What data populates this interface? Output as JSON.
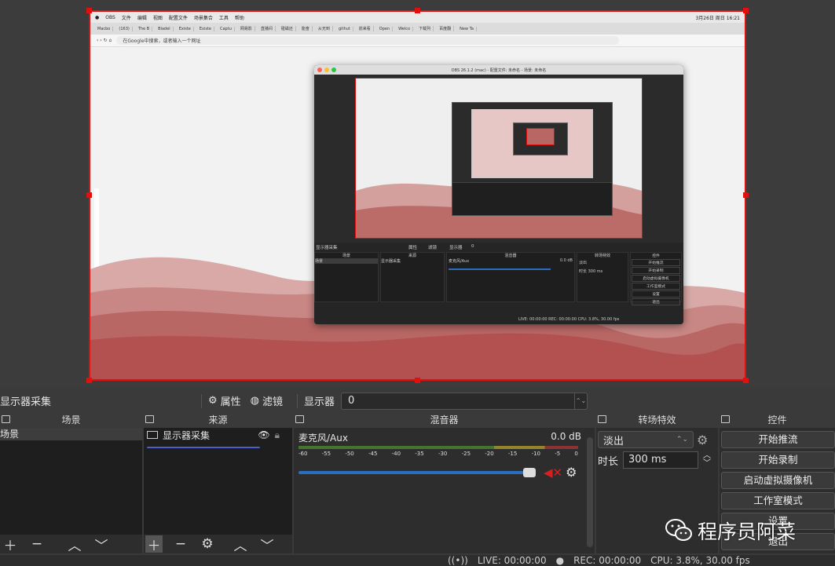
{
  "nested": {
    "mac_menu": [
      "OBS",
      "文件",
      "编辑",
      "视图",
      "配置文件",
      "场景集合",
      "工具",
      "帮助"
    ],
    "mac_clock": "3月26日 周日 16:21",
    "browser_tabs": [
      "Macbo",
      "(163)",
      "The B",
      "Bladel",
      "Existe",
      "Existe",
      "Captu",
      "网易影",
      "直播间",
      "碰磁还",
      "能奋",
      "从无到",
      "githut",
      "前来看",
      "Open",
      "Welco",
      "下载列",
      "百度翻",
      "New Ta"
    ],
    "address_text": "在Google中搜索，或者输入一个网址",
    "obs_window_title": "OBS 26.1.2 (mac) - 配置文件: 未命名 - 场景: 未命名",
    "obs_inner_labels": {
      "scene_bar": "显示器采集",
      "props": "属性",
      "filters": "滤镜",
      "display": "显示器",
      "display_val": "0",
      "scenes": "场景",
      "sources": "来源",
      "mixer": "混音器",
      "transitions": "转场特效",
      "controls": "控件",
      "scene_item": "场景",
      "source_item": "显示器采集",
      "mic": "麦克风/Aux",
      "mic_db": "0.0 dB",
      "fade": "淡出",
      "duration_label": "时长",
      "duration_val": "300 ms",
      "buttons": [
        "开始推流",
        "开始录制",
        "启动虚拟摄像机",
        "工作室模式",
        "设置",
        "退出"
      ],
      "status": "LIVE: 00:00:00   REC: 00:00:00   CPU: 3.8%, 30.00 fps"
    }
  },
  "scene_bar": {
    "source_name": "显示器采集",
    "properties_label": "属性",
    "filters_label": "滤镜",
    "display_label": "显示器",
    "display_value": "0"
  },
  "docks": {
    "scenes": {
      "title": "场景",
      "items": [
        "场景"
      ]
    },
    "sources": {
      "title": "来源",
      "items": [
        "显示器采集"
      ]
    },
    "mixer": {
      "title": "混音器",
      "channel": "麦克风/Aux",
      "db": "0.0 dB",
      "ticks": [
        "-60",
        "-55",
        "-50",
        "-45",
        "-40",
        "-35",
        "-30",
        "-25",
        "-20",
        "-15",
        "-10",
        "-5",
        "0"
      ]
    },
    "transitions": {
      "title": "转场特效",
      "selected": "淡出",
      "duration_label": "时长",
      "duration_value": "300 ms"
    },
    "controls": {
      "title": "控件",
      "buttons": [
        "开始推流",
        "开始录制",
        "启动虚拟摄像机",
        "工作室模式",
        "设置",
        "退出"
      ]
    }
  },
  "status": {
    "live": "LIVE: 00:00:00",
    "rec": "REC: 00:00:00",
    "cpu": "CPU: 3.8%, 30.00 fps"
  },
  "watermark": {
    "text": "程序员阿菜",
    "icon": "wechat-icon"
  },
  "colors": {
    "selection_red": "#e01010",
    "mixer_slider": "#2a6ec0",
    "mute_red": "#d42020"
  }
}
